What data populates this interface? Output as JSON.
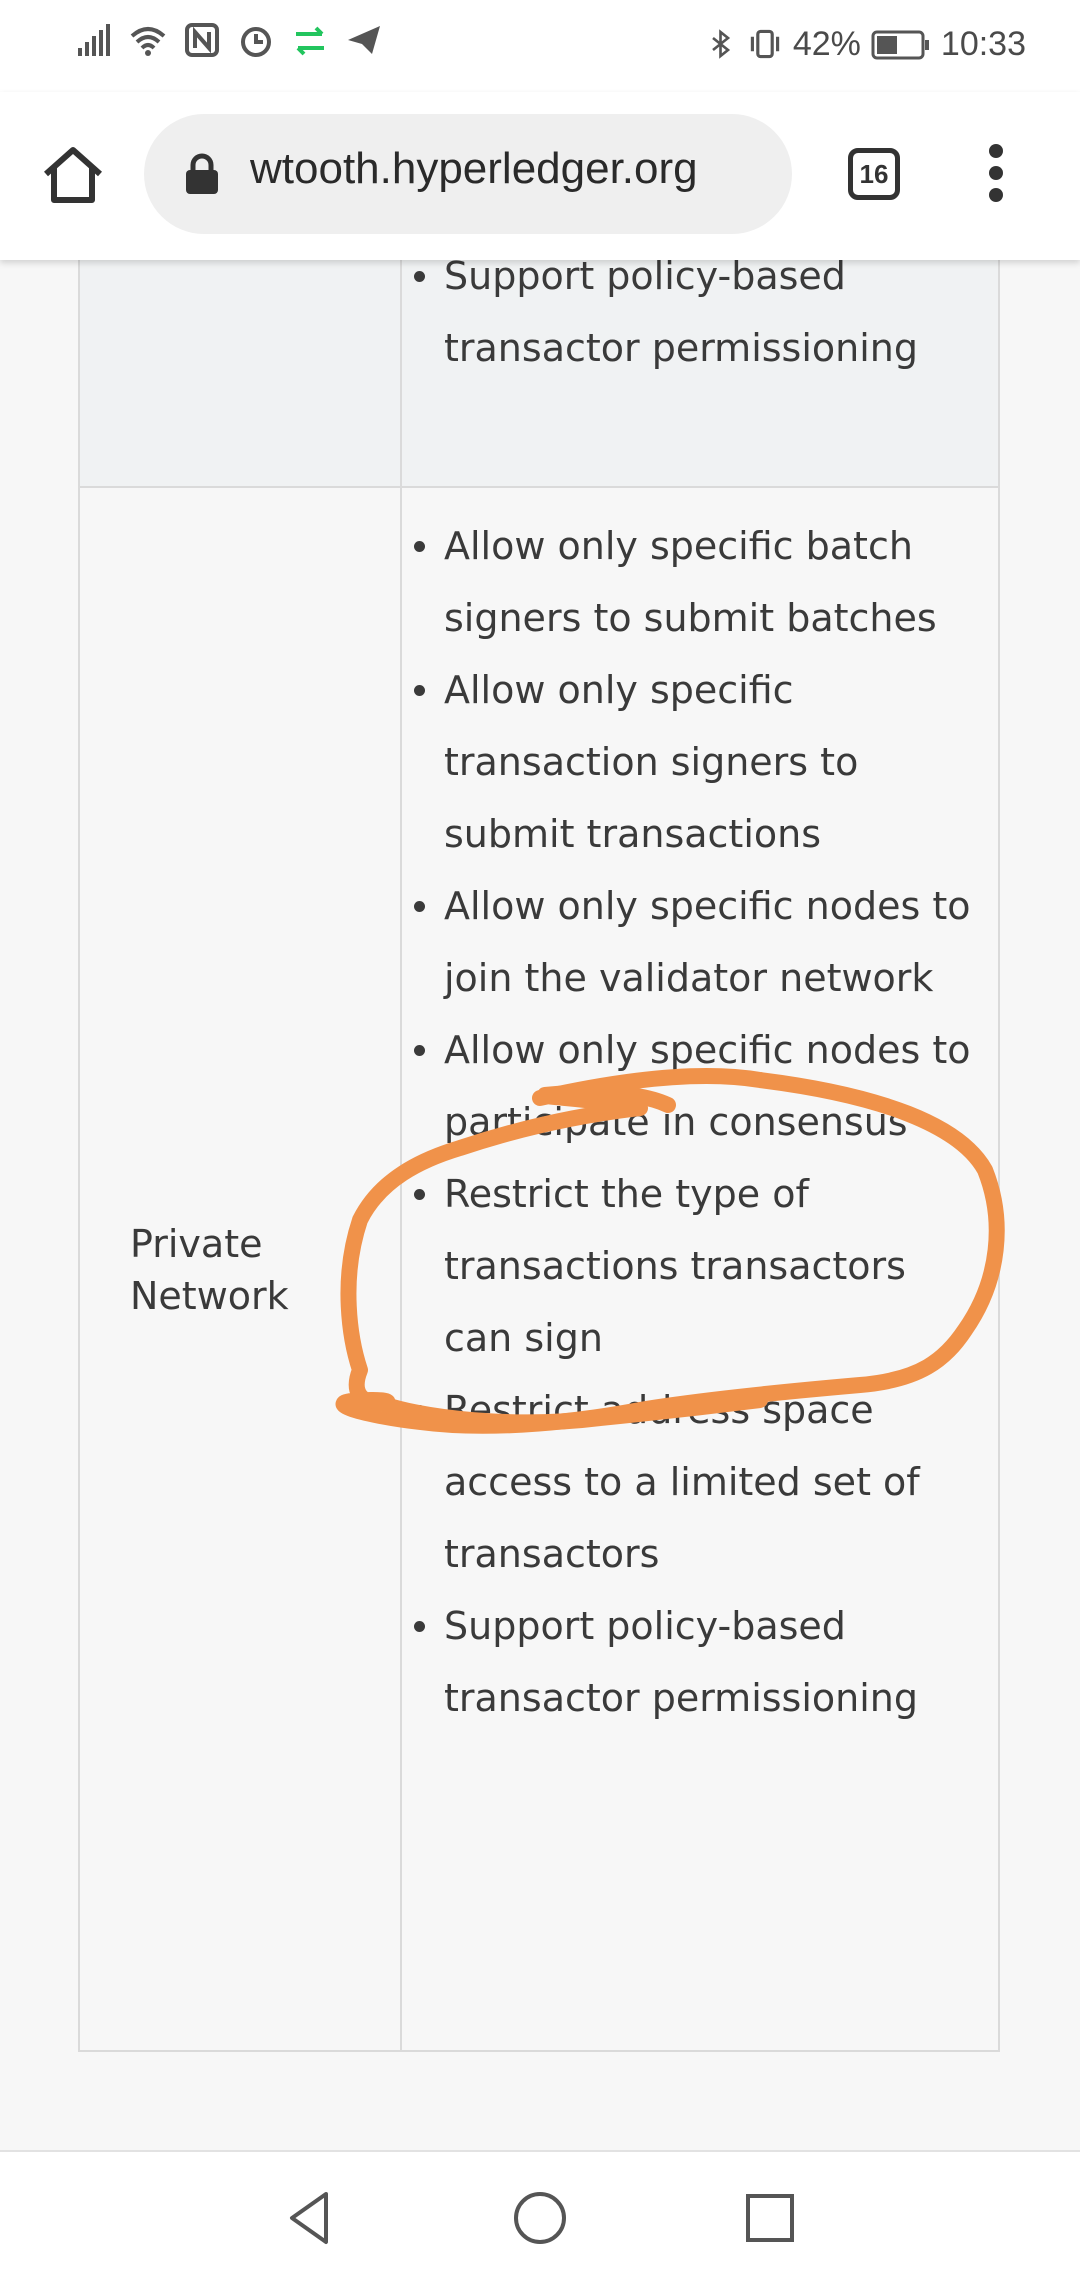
{
  "status_bar": {
    "battery": "42%",
    "time": "10:33"
  },
  "browser": {
    "url": "wtooth.hyperledger.org",
    "tab_count": "16"
  },
  "table": {
    "prev_row": {
      "items": [
        "Support policy-based transactor permissioning"
      ]
    },
    "private_network": {
      "label": "Private Network",
      "items": [
        "Allow only specific batch signers to submit batches",
        "Allow only specific transaction signers to submit transactions",
        "Allow only specific nodes to join the validator network",
        "Allow only specific nodes to participate in consensus",
        "Restrict the type of transactions transactors can sign",
        "Restrict address space access to a limited set of transactors",
        "Support policy-based transactor permissioning"
      ]
    }
  },
  "annotation": {
    "color": "#f0924a"
  },
  "icons": [
    "signal-icon",
    "wifi-icon",
    "nfc-icon",
    "alarm-icon",
    "data-transfer-icon",
    "telegram-icon",
    "bluetooth-icon",
    "vibrate-icon",
    "battery-icon",
    "home-icon",
    "lock-icon",
    "tabs-icon",
    "menu-icon",
    "back-icon",
    "home-nav-icon",
    "recents-icon"
  ]
}
